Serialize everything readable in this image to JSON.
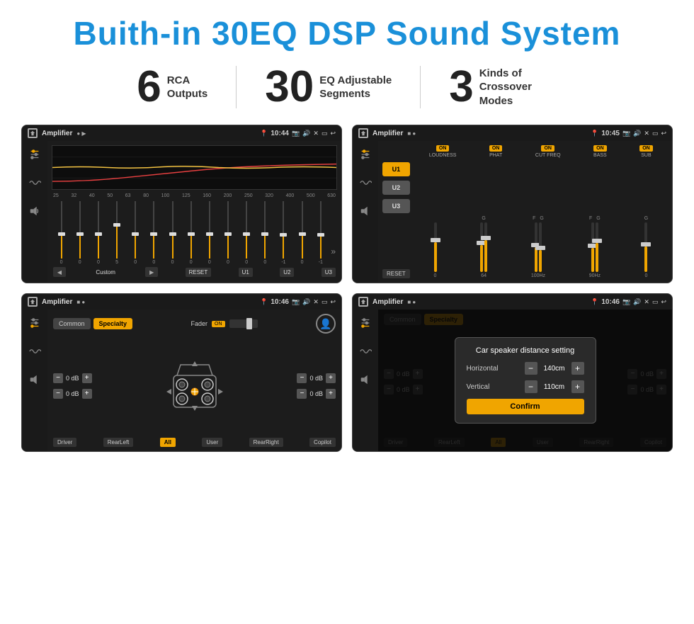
{
  "header": {
    "title": "Buith-in 30EQ DSP Sound System"
  },
  "stats": [
    {
      "number": "6",
      "label": "RCA\nOutputs"
    },
    {
      "number": "30",
      "label": "EQ Adjustable\nSegments"
    },
    {
      "number": "3",
      "label": "Kinds of\nCrossover Modes"
    }
  ],
  "screens": {
    "eq": {
      "title": "Amplifier",
      "time": "10:44",
      "frequencies": [
        "25",
        "32",
        "40",
        "50",
        "63",
        "80",
        "100",
        "125",
        "160",
        "200",
        "250",
        "320",
        "400",
        "500",
        "630"
      ],
      "values": [
        "0",
        "0",
        "0",
        "5",
        "0",
        "0",
        "0",
        "0",
        "0",
        "0",
        "0",
        "0",
        "-1",
        "0",
        "-1"
      ],
      "preset": "Custom",
      "buttons": [
        "U1",
        "U2",
        "U3",
        "RESET"
      ]
    },
    "crossover": {
      "title": "Amplifier",
      "time": "10:45",
      "channels": [
        "U1",
        "U2",
        "U3"
      ],
      "labels": [
        "LOUDNESS",
        "PHAT",
        "CUT FREQ",
        "BASS",
        "SUB"
      ],
      "reset": "RESET"
    },
    "fader": {
      "title": "Amplifier",
      "time": "10:46",
      "tabs": [
        "Common",
        "Specialty"
      ],
      "fader_label": "Fader",
      "on": "ON",
      "db_values": [
        "0 dB",
        "0 dB",
        "0 dB",
        "0 dB"
      ],
      "bottom_buttons": [
        "Driver",
        "RearLeft",
        "All",
        "User",
        "RearRight",
        "Copilot"
      ]
    },
    "dialog": {
      "title": "Amplifier",
      "time": "10:46",
      "modal_title": "Car speaker distance setting",
      "horizontal_label": "Horizontal",
      "horizontal_value": "140cm",
      "vertical_label": "Vertical",
      "vertical_value": "110cm",
      "confirm_label": "Confirm",
      "bottom_buttons": [
        "Driver",
        "RearLeft",
        "All",
        "User",
        "RearRight",
        "Copilot"
      ]
    }
  },
  "icons": {
    "home": "⌂",
    "back": "↩",
    "settings": "⚙",
    "eq_icon": "≋",
    "wave_icon": "∿",
    "speaker_icon": "◈",
    "minus": "−",
    "plus": "+"
  }
}
